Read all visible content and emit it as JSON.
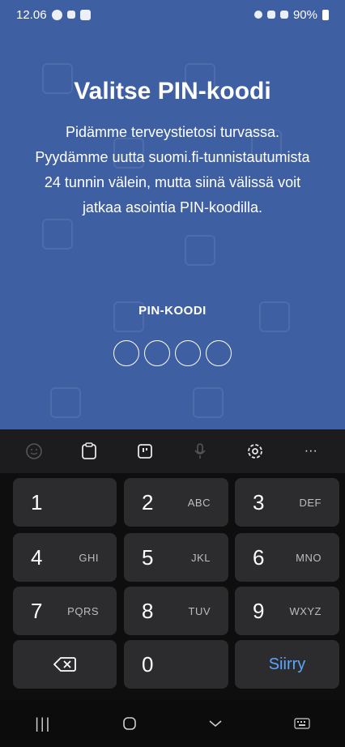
{
  "status_bar": {
    "time": "12.06",
    "battery_percent": "90%"
  },
  "app": {
    "title": "Valitse PIN-koodi",
    "description": "Pidämme terveystietosi turvassa. Pyydämme uutta suomi.fi-tunnistautumista 24 tunnin välein, mutta siinä välissä voit jatkaa asointia PIN-koodilla.",
    "pin_label": "PIN-KOODI",
    "pin_slots_filled": 0,
    "pin_slots_total": 4,
    "colors": {
      "background": "#3f5fa3",
      "text": "#ffffff"
    }
  },
  "keyboard": {
    "toolbar": {
      "icons": [
        "emoji-icon",
        "clipboard-icon",
        "sticker-icon",
        "microphone-icon",
        "settings-icon",
        "more-icon"
      ],
      "more_label": "···"
    },
    "keys": [
      {
        "digit": "1",
        "letters": ""
      },
      {
        "digit": "2",
        "letters": "ABC"
      },
      {
        "digit": "3",
        "letters": "DEF"
      },
      {
        "digit": "4",
        "letters": "GHI"
      },
      {
        "digit": "5",
        "letters": "JKL"
      },
      {
        "digit": "6",
        "letters": "MNO"
      },
      {
        "digit": "7",
        "letters": "PQRS"
      },
      {
        "digit": "8",
        "letters": "TUV"
      },
      {
        "digit": "9",
        "letters": "WXYZ"
      },
      {
        "digit": "0",
        "letters": ""
      }
    ],
    "go_label": "Siirry",
    "accent_color": "#5aa6ff"
  },
  "navbar": {
    "recents_glyph": "|||",
    "home_glyph": "○",
    "back_glyph": "∨",
    "keyboard_glyph": "⌨"
  }
}
